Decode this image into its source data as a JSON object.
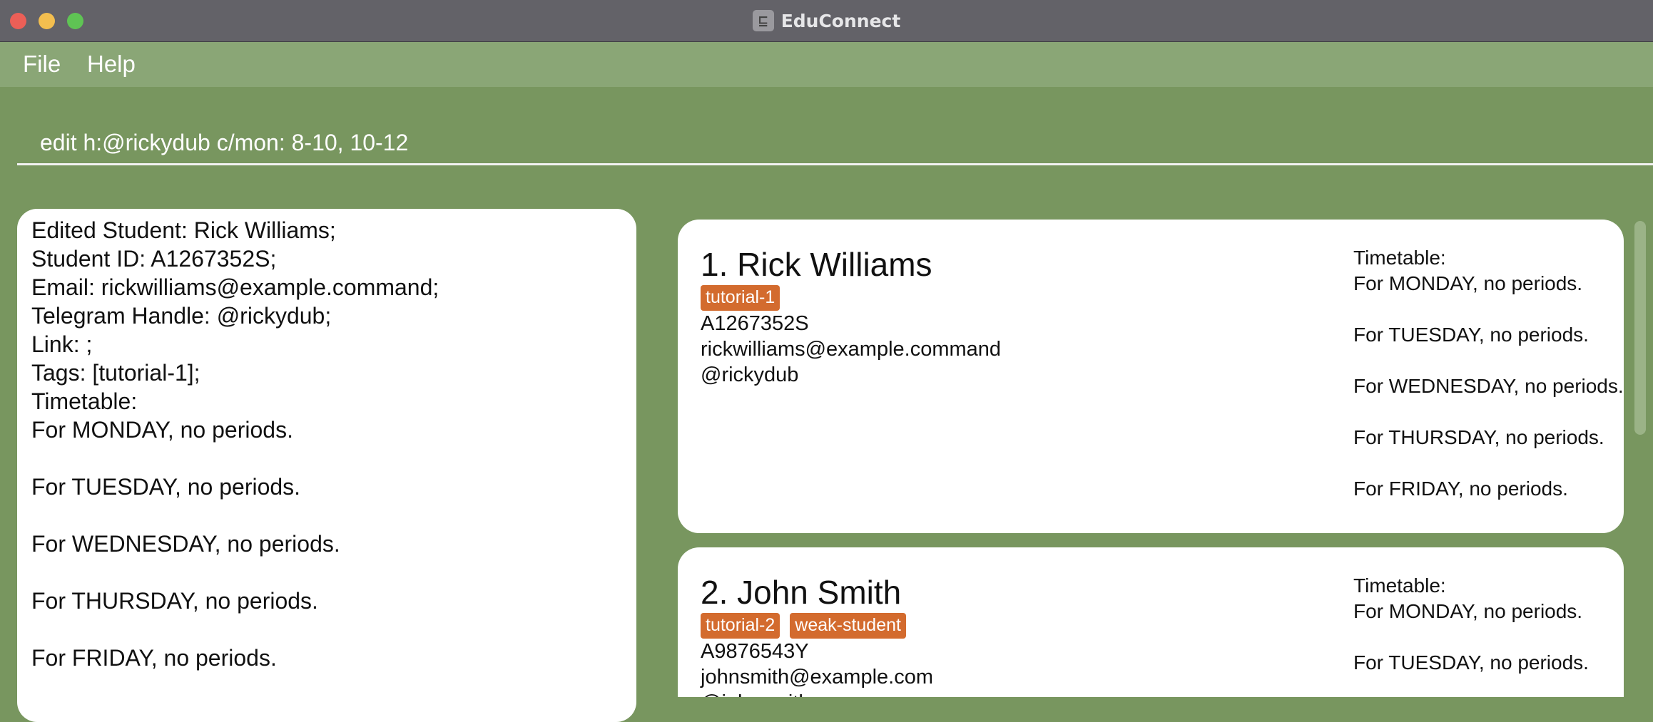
{
  "window": {
    "title": "EduConnect",
    "icon": "educonnect-app-icon"
  },
  "menu": {
    "file": "File",
    "help": "Help"
  },
  "command": {
    "value": "edit h:@rickydub c/mon: 8-10, 10-12"
  },
  "result": {
    "lines": [
      "Edited Student: Rick Williams;",
      "Student ID: A1267352S;",
      "Email: rickwilliams@example.command;",
      "Telegram Handle: @rickydub;",
      "Link: ;",
      "Tags: [tutorial-1];",
      "Timetable:",
      "For MONDAY, no periods.",
      "For TUESDAY, no periods.",
      "For WEDNESDAY, no periods.",
      "For THURSDAY, no periods.",
      "For FRIDAY, no periods."
    ]
  },
  "students": [
    {
      "name": "1.  Rick Williams",
      "tags": [
        "tutorial-1"
      ],
      "id": "A1267352S",
      "email": "rickwilliams@example.command",
      "handle": "@rickydub",
      "timetable_label": "Timetable:",
      "timetable": [
        "For MONDAY, no periods.",
        "For TUESDAY, no periods.",
        "For WEDNESDAY, no periods.",
        "For THURSDAY, no periods.",
        "For FRIDAY, no periods."
      ]
    },
    {
      "name": "2.  John Smith",
      "tags": [
        "tutorial-2",
        "weak-student"
      ],
      "id": "A9876543Y",
      "email": "johnsmith@example.com",
      "handle": "@johnsmith",
      "timetable_label": "Timetable:",
      "timetable": [
        "For MONDAY, no periods.",
        "For TUESDAY, no periods."
      ]
    }
  ],
  "colors": {
    "background": "#78965f",
    "menubar": "#8aa676",
    "tag": "#d36b2e"
  }
}
